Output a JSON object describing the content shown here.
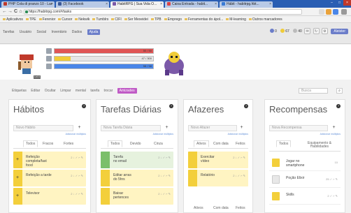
{
  "browser": {
    "tabs": [
      {
        "label": "PHP Cola di pranzo 10 - Lar",
        "active": false
      },
      {
        "label": "(3) Facebook",
        "active": false
      },
      {
        "label": "HabitRPG | Sua Vida O...",
        "active": true
      },
      {
        "label": "Caixa Entrada - habit...",
        "active": false
      },
      {
        "label": "Hábit - habitrpg.hbt...",
        "active": false
      }
    ],
    "url": "https://habitrpg.com/#/tasks",
    "back": "←",
    "forward": "→",
    "reload": "C",
    "home": "⌂",
    "bookmarks": [
      "Aplicativos",
      "TPE",
      "Ferenior",
      "Cursor",
      "Nekwik",
      "Tumblrs",
      "CIFI",
      "Ser Mexeidei",
      "TPB",
      "Emprego",
      "Ferramentas do ápol...",
      "M-learning",
      "Outros marcadores"
    ]
  },
  "app": {
    "menu": [
      "Tarefas",
      "Usuário",
      "Social",
      "Inventário",
      "Dados"
    ],
    "active_menu": "Ajuda",
    "gold": "0",
    "silver": "67",
    "gems": "40",
    "profile": "Aleister",
    "hud": {
      "hp_value": "50 / 50",
      "xp_value": "47 / 300",
      "mp_value": "58 / 58",
      "hp_fraction": 1.0,
      "xp_fraction": 0.16,
      "mp_fraction": 1.0,
      "level": "Lvl 4"
    },
    "colors": {
      "hp": "#e05555",
      "xp": "#f0cc38",
      "mp": "#4a86e8",
      "accent": "#6b7dc9"
    },
    "filters": [
      "Etiquetas",
      "Editar",
      "Ocultar",
      "Limpar",
      "mental",
      "tarefa",
      "trocar"
    ],
    "active_filter": "Amizades",
    "search_placeholder": "Busca"
  },
  "columns": {
    "habits": {
      "title": "Hábitos",
      "placeholder": "Novo Hábito",
      "hint": "Adicionar múltiplos",
      "tabs": [
        "Todos",
        "Fracos",
        "Fortes"
      ],
      "tasks": [
        {
          "text": "Refeição completa/fast food",
          "meta": "2 ↓ ✓ ⌐ ✎"
        },
        {
          "text": "Refeição a tarde",
          "meta": "2 ↓ ✓ ⌐ ✎"
        },
        {
          "text": "Televisor",
          "meta": "2 ↓ ✓ ⌐ ✎"
        }
      ]
    },
    "dailies": {
      "title": "Tarefas Diárias",
      "placeholder": "Nova Tarefa Diária",
      "hint": "Adicionar múltiplos",
      "tabs": [
        "Todos",
        "Devido",
        "Cinza"
      ],
      "tasks": [
        {
          "text": "Tarefa",
          "text2": "no email",
          "meta": "2 ↓ ✓ ⌐ ✎"
        },
        {
          "text": "Editar arras",
          "text2": "do 5hrs",
          "meta": "2 ↓ ✓ ⌐ ✎"
        },
        {
          "text": "Baixar",
          "text2": "pertences",
          "meta": "2 ↓ ✓ ⌐ ✎"
        }
      ]
    },
    "todos": {
      "title": "Afazeres",
      "placeholder": "Novo Afazer",
      "hint": "Adicionar múltiplos",
      "tabs": [
        "Ativos",
        "Com data",
        "Feitos"
      ],
      "tasks": [
        {
          "text": "Exercitar vídeo",
          "meta": "2 ↓ ✓ ⌐ ✎"
        },
        {
          "text": "Relatório",
          "meta": "2 ↓ ✓ ⌐ ✎"
        }
      ],
      "footer_tabs": [
        "Ativos",
        "Com data",
        "Feitos"
      ]
    },
    "rewards": {
      "title": "Recompensas",
      "placeholder": "Nova Recompensa",
      "hint": "Adicionar múltiplos",
      "tabs": [
        "Todos",
        "Equipamento & Habilidades"
      ],
      "items": [
        {
          "text": "Jogar no smartphone",
          "price": "10"
        },
        {
          "text": "Poção Elixir",
          "price": "25 ✓ ⌐ ✎"
        },
        {
          "text": "Skills",
          "price": "2 ✓ ⌐ ✎"
        }
      ]
    }
  }
}
